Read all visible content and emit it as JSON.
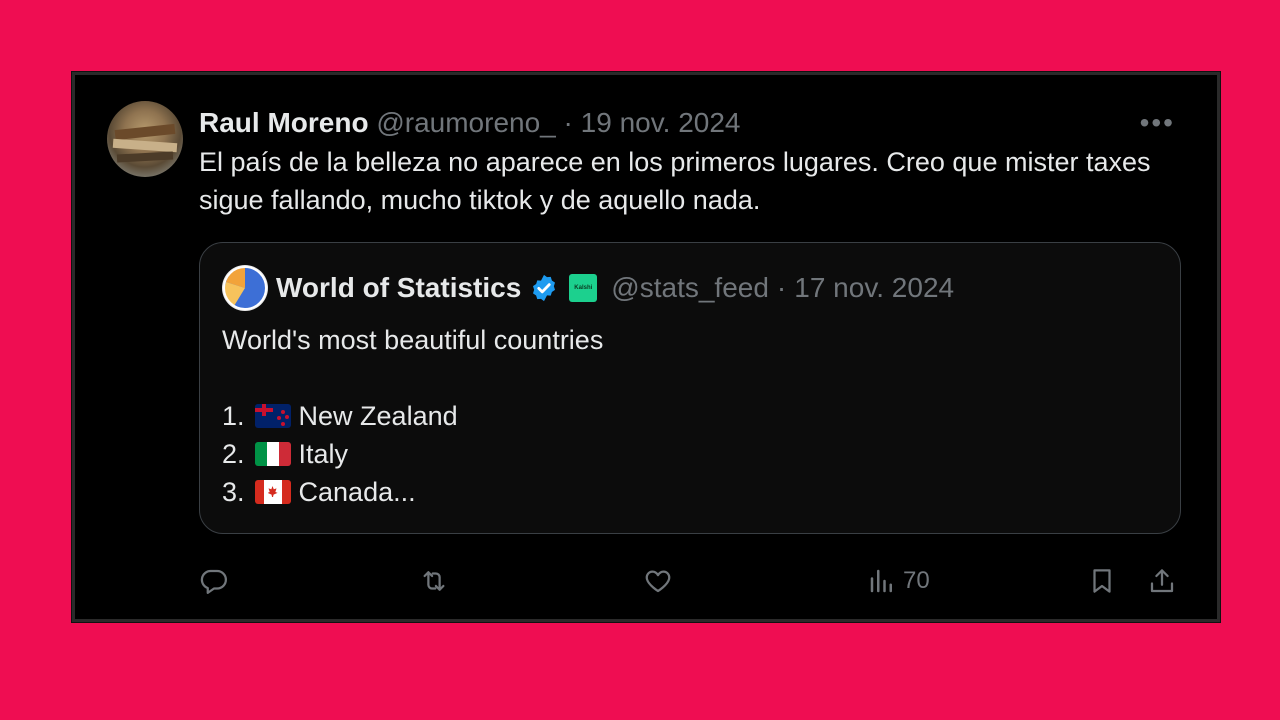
{
  "tweet": {
    "author_name": "Raul Moreno",
    "handle": "@raumoreno_",
    "separator": "·",
    "date": "19 nov. 2024",
    "text": "El país de la belleza no aparece en los primeros lugares. Creo que mister taxes sigue fallando, mucho tiktok y de aquello nada.",
    "more_label": "•••"
  },
  "quote": {
    "author_name": "World of Statistics",
    "affiliate_badge": "Kalshi",
    "handle": "@stats_feed",
    "separator": "·",
    "date": "17 nov. 2024",
    "title": "World's most beautiful countries",
    "list": [
      {
        "num": "1.",
        "flag": "new-zealand-flag",
        "label": "New Zealand"
      },
      {
        "num": "2.",
        "flag": "italy-flag",
        "label": "Italy"
      },
      {
        "num": "3.",
        "flag": "canada-flag",
        "label": "Canada..."
      }
    ]
  },
  "actions": {
    "reply_icon": "reply-icon",
    "retweet_icon": "retweet-icon",
    "like_icon": "like-icon",
    "views_icon": "views-icon",
    "views_count": "70",
    "bookmark_icon": "bookmark-icon",
    "share_icon": "share-icon"
  },
  "colors": {
    "background": "#ef0d52",
    "card": "#000000",
    "text": "#e7e9ea",
    "muted": "#71767b",
    "verified": "#1d9bf0"
  }
}
